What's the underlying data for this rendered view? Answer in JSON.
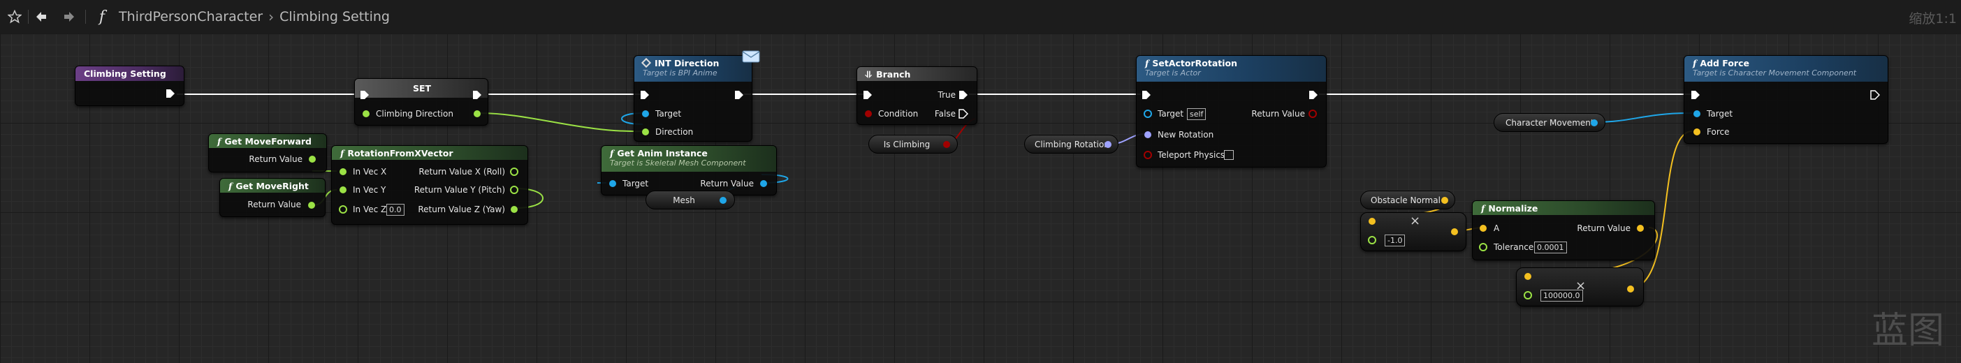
{
  "breadcrumb": {
    "blueprint": "ThirdPersonCharacter",
    "graph": "Climbing Setting"
  },
  "zoom_label": "缩放1:1",
  "watermark": "蓝图",
  "toolbar": {
    "favorite_icon": "star-icon",
    "back_icon": "back-arrow-icon",
    "forward_icon": "forward-arrow-icon",
    "function_icon": "f"
  },
  "nodes": {
    "climbing_setting": {
      "title": "Climbing Setting"
    },
    "set": {
      "title": "SET",
      "pin": "Climbing Direction"
    },
    "get_move_forward": {
      "fx": "f",
      "title": "Get MoveForward",
      "out": "Return Value"
    },
    "get_move_right": {
      "fx": "f",
      "title": "Get MoveRight",
      "out": "Return Value"
    },
    "rotation_from_x": {
      "fx": "f",
      "title": "RotationFromXVector",
      "in_x": "In Vec X",
      "in_y": "In Vec Y",
      "in_z": "In Vec Z",
      "z_value": "0.0",
      "out_x": "Return Value X (Roll)",
      "out_y": "Return Value Y (Pitch)",
      "out_z": "Return Value Z (Yaw)"
    },
    "int_direction": {
      "title": "INT Direction",
      "subtitle": "Target is BPI Anime",
      "target": "Target",
      "direction": "Direction"
    },
    "get_anim_instance": {
      "fx": "f",
      "title": "Get Anim Instance",
      "subtitle": "Target is Skeletal Mesh Component",
      "target": "Target",
      "out": "Return Value"
    },
    "mesh": {
      "label": "Mesh"
    },
    "branch": {
      "title": "Branch",
      "condition": "Condition",
      "true_label": "True",
      "false_label": "False"
    },
    "is_climbing": {
      "label": "Is Climbing"
    },
    "set_actor_rotation": {
      "fx": "f",
      "title": "SetActorRotation",
      "subtitle": "Target is Actor",
      "target": "Target",
      "target_value": "self",
      "new_rotation": "New Rotation",
      "teleport": "Teleport Physics",
      "out": "Return Value"
    },
    "climbing_rotation": {
      "label": "Climbing Rotation"
    },
    "add_force": {
      "fx": "f",
      "title": "Add Force",
      "subtitle": "Target is Character Movement Component",
      "target": "Target",
      "force": "Force"
    },
    "character_movement": {
      "label": "Character Movement"
    },
    "obstacle_normal": {
      "label": "Obstacle Normal"
    },
    "multiply_1": {
      "value": "-1.0",
      "op": "×"
    },
    "normalize": {
      "fx": "f",
      "title": "Normalize",
      "a": "A",
      "tolerance": "Tolerance",
      "tolerance_value": "0.0001",
      "out": "Return Value"
    },
    "multiply_2": {
      "value": "100000.0",
      "op": "×"
    }
  },
  "pin_colors": {
    "exec": "#ffffff",
    "vector": "#f4c020",
    "rotator": "#9ea2ff",
    "float": "#9be245",
    "object": "#1fa6e8",
    "bool": "#a10000",
    "interface": "#e6ffb3"
  }
}
